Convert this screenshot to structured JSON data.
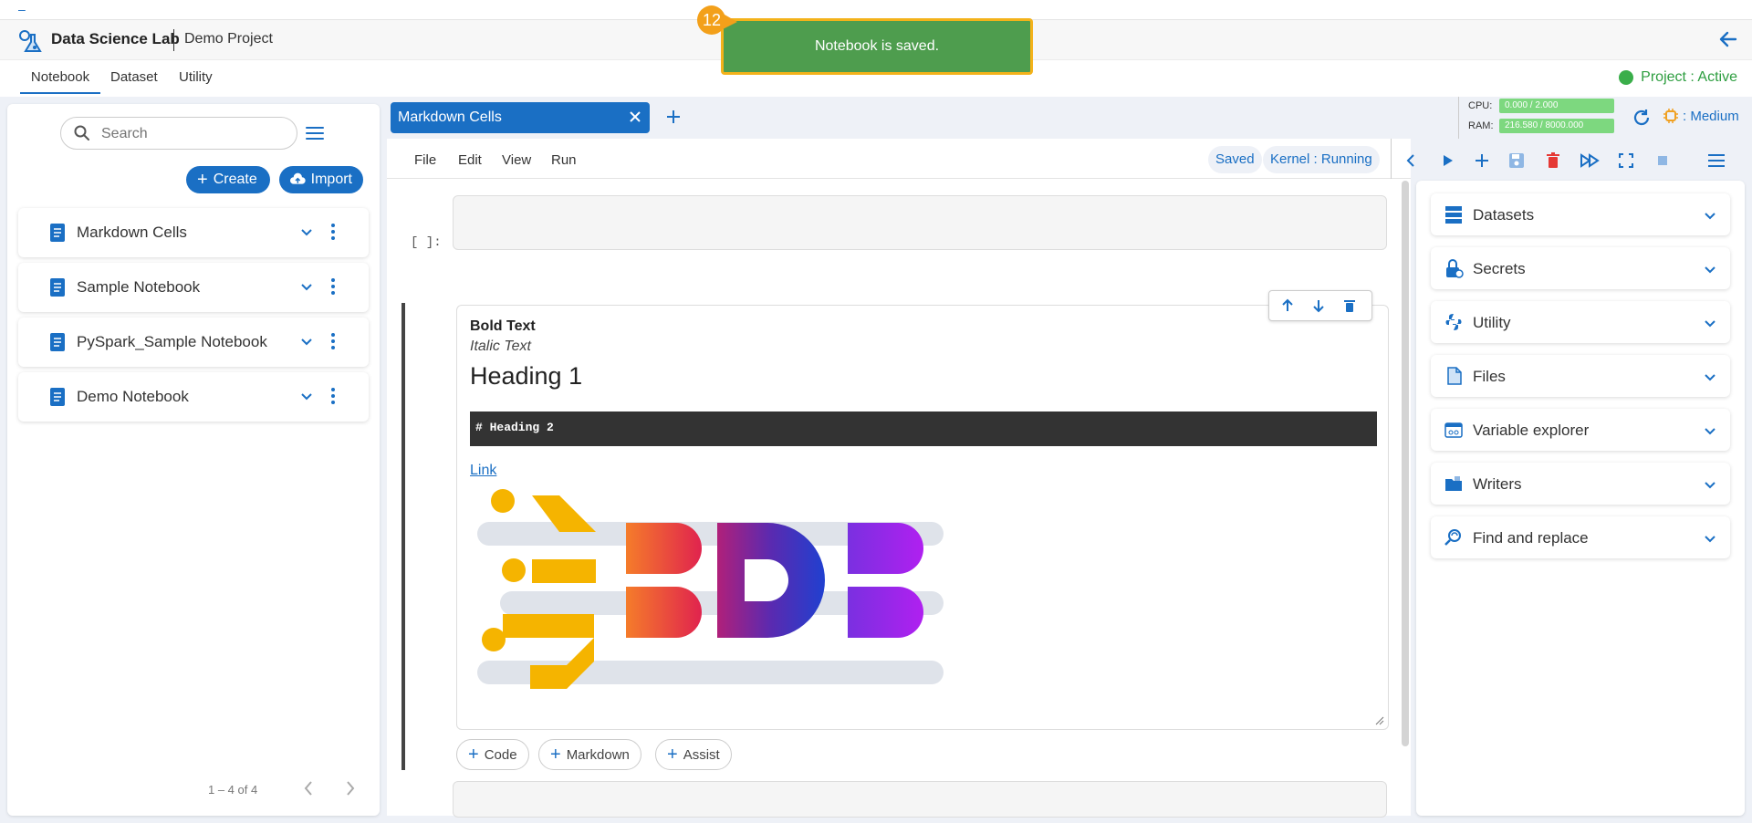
{
  "header": {
    "app_title": "Data Science Lab",
    "project_name": "Demo Project"
  },
  "nav": {
    "tabs": [
      "Notebook",
      "Dataset",
      "Utility"
    ],
    "active": "Notebook",
    "project_status": "Project : Active"
  },
  "toast": {
    "message": "Notebook is saved.",
    "step_number": "12"
  },
  "sidebar": {
    "search_placeholder": "Search",
    "create_label": "Create",
    "import_label": "Import",
    "notebooks": [
      "Markdown Cells",
      "Sample Notebook",
      "PySpark_Sample Notebook",
      "Demo Notebook"
    ],
    "pager": "1 – 4 of 4"
  },
  "editor": {
    "open_tab": "Markdown Cells",
    "menu": [
      "File",
      "Edit",
      "View",
      "Run"
    ],
    "saved_label": "Saved",
    "kernel_label": "Kernel : Running",
    "cpu_label": "CPU:",
    "cpu_value": "0.000 / 2.000",
    "ram_label": "RAM:",
    "ram_value": "216.580 / 8000.000",
    "size_label": ": Medium",
    "exec_count": "[   ]:",
    "markdown": {
      "bold": "Bold Text",
      "italic": "Italic Text",
      "h1": "Heading 1",
      "code": "# Heading 2",
      "link": "Link"
    },
    "add_buttons": [
      "Code",
      "Markdown",
      "Assist"
    ]
  },
  "right_panel": {
    "sections": [
      "Datasets",
      "Secrets",
      "Utility",
      "Files",
      "Variable explorer",
      "Writers",
      "Find and replace"
    ]
  },
  "colors": {
    "primary": "#1a6fc4",
    "toast_bg": "#4e9d4e",
    "toast_border": "#f3b21a",
    "status_green": "#3aae4a",
    "resource_bar": "#7dd87f"
  }
}
